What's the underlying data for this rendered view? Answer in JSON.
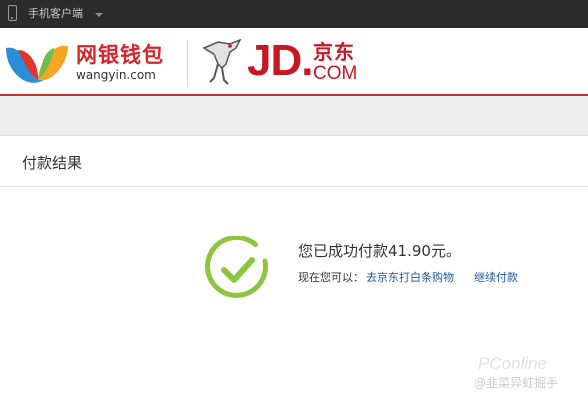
{
  "topbar": {
    "mobile_client": "手机客户端"
  },
  "header": {
    "wangyin_name": "网银钱包",
    "wangyin_domain": "wangyin.com",
    "jd_big": "JD.",
    "jd_cn": "京东",
    "jd_com": "COM"
  },
  "panel": {
    "title": "付款结果",
    "message": "您已成功付款41.90元。",
    "prompt": "现在您可以：",
    "link_go_shop": "去京东打白条购物",
    "link_continue": "继续付款"
  },
  "watermark": {
    "site": "PConline",
    "author": "@韭菜异虹掘手"
  },
  "colors": {
    "topbar_bg": "#2b2b2b",
    "brand_red": "#c91623",
    "success_green": "#8cc63f",
    "link_blue": "#1e5a9a"
  }
}
